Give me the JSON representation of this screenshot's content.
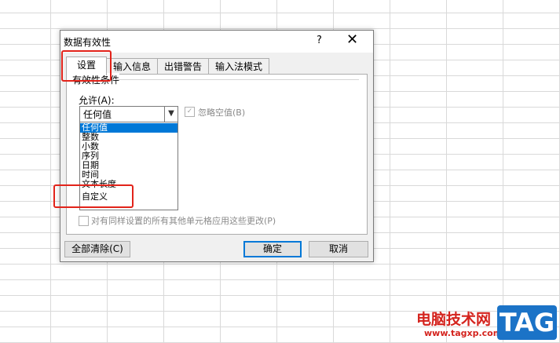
{
  "dialog": {
    "title": "数据有效性",
    "help": "?",
    "close": "✕"
  },
  "tabs": [
    {
      "label": "设置",
      "active": true
    },
    {
      "label": "输入信息",
      "active": false
    },
    {
      "label": "出错警告",
      "active": false
    },
    {
      "label": "输入法模式",
      "active": false
    }
  ],
  "settings": {
    "group_label": "有效性条件",
    "allow_label": "允许(A):",
    "allow_value": "任何值",
    "allow_options": [
      "任何值",
      "整数",
      "小数",
      "序列",
      "日期",
      "时间",
      "文本长度",
      "自定义"
    ],
    "ignore_blank_label": "忽略空值(B)",
    "ignore_blank_checked": true,
    "apply_all_label": "对有同样设置的所有其他单元格应用这些更改(P)",
    "apply_all_checked": false
  },
  "buttons": {
    "clear_all": "全部清除(C)",
    "ok": "确定",
    "cancel": "取消"
  },
  "watermark": {
    "text": "电脑技术网",
    "url": "www.tagxp.com",
    "tag": "TAG"
  },
  "colors": {
    "highlight": "#e2231a",
    "selection": "#0078d7",
    "tag_bg": "#1b73c7"
  }
}
